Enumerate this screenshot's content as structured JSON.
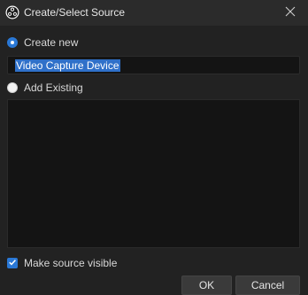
{
  "window": {
    "title": "Create/Select Source",
    "app_icon": "obs-logo-icon",
    "close_icon": "close-icon"
  },
  "options": {
    "create_new": {
      "label": "Create new",
      "selected": true
    },
    "source_name": {
      "value": "Video Capture Device",
      "text_selected": true
    },
    "add_existing": {
      "label": "Add Existing",
      "selected": false
    },
    "existing_sources": []
  },
  "visibility": {
    "label": "Make source visible",
    "checked": true
  },
  "buttons": {
    "ok": "OK",
    "cancel": "Cancel"
  },
  "colors": {
    "accent": "#2a78d6",
    "selection": "#2f70c9",
    "background": "#222222",
    "input_background": "#141414"
  }
}
